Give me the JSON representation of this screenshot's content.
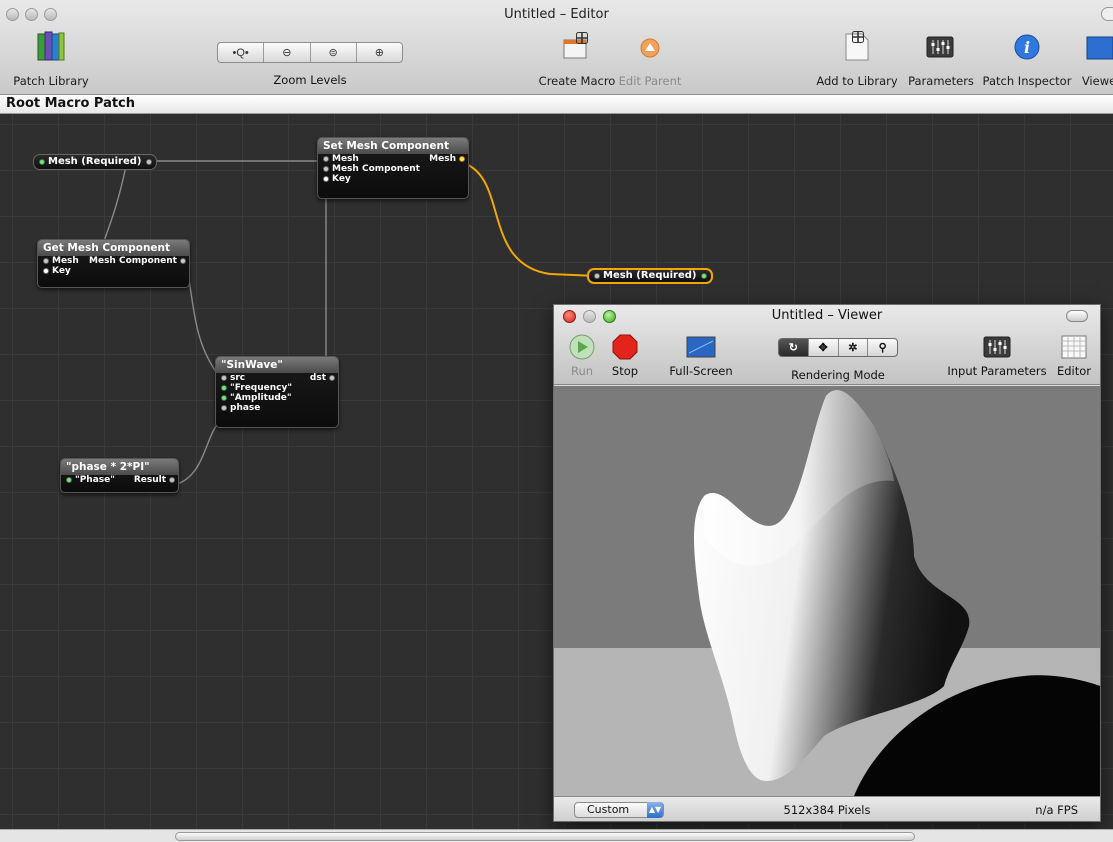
{
  "window": {
    "title": "Untitled – Editor"
  },
  "toolbar": {
    "patch_library": "Patch Library",
    "zoom_levels": "Zoom Levels",
    "create_macro": "Create Macro",
    "edit_parent": "Edit Parent",
    "add_to_library": "Add to Library",
    "parameters": "Parameters",
    "patch_inspector": "Patch Inspector",
    "viewer": "Viewe"
  },
  "breadcrumb": "Root Macro Patch",
  "patches": {
    "mesh_input": {
      "label": "Mesh (Required)"
    },
    "set_mesh": {
      "title": "Set Mesh Component",
      "in1": "Mesh",
      "in2": "Mesh Component",
      "in3": "Key",
      "out": "Mesh"
    },
    "get_mesh": {
      "title": "Get Mesh Component",
      "in1": "Mesh",
      "in2": "Key",
      "out": "Mesh Component"
    },
    "sinwave": {
      "title": "\"SinWave\"",
      "in1": "src",
      "in2": "\"Frequency\"",
      "in3": "\"Amplitude\"",
      "in4": "phase",
      "out": "dst"
    },
    "math": {
      "title": "\"phase * 2*PI\"",
      "in1": "\"Phase\"",
      "out": "Result"
    },
    "mesh_output": {
      "label": "Mesh (Required)"
    }
  },
  "viewer": {
    "title": "Untitled – Viewer",
    "run": "Run",
    "stop": "Stop",
    "fullscreen": "Full-Screen",
    "rendering_mode": "Rendering Mode",
    "input_parameters": "Input Parameters",
    "editor": "Editor",
    "size_popup": "Custom",
    "pixels": "512x384 Pixels",
    "fps": "n/a FPS"
  }
}
